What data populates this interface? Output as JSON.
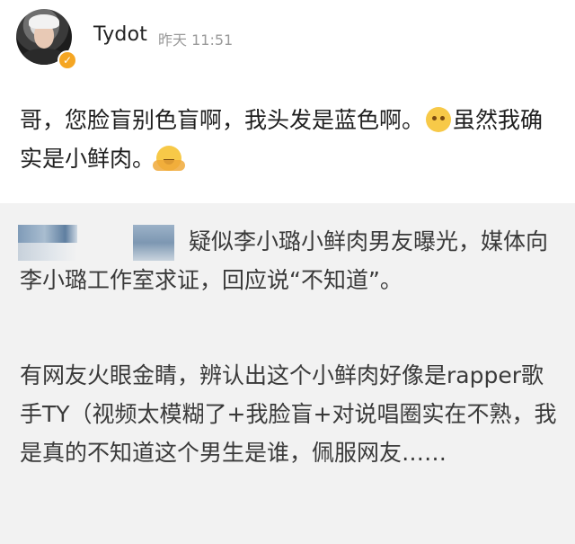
{
  "post": {
    "author": {
      "name": "Tydot",
      "avatar_icon": "user-avatar",
      "verified_icon": "verified-v-badge",
      "verified_color": "#f5a623"
    },
    "timestamp": "昨天 11:51",
    "content": {
      "line1_a": "哥，您脸盲别色盲啊，我头发是蓝色啊。",
      "emoji1": "sad-face-emoji",
      "line1_b": "虽然我确实是小鲜肉。",
      "emoji2": "hugging-face-emoji"
    }
  },
  "quoted": {
    "paragraph1": "疑似李小璐小鲜肉男友曝光，媒体向李小璐工作室求证，回应说“不知道”。",
    "paragraph2": "有网友火眼金睛，辨认出这个小鲜肉好像是rapper歌手TY（视频太模糊了+我脸盲+对说唱圈实在不熟，我是真的不知道这个男生是谁，佩服网友……"
  }
}
